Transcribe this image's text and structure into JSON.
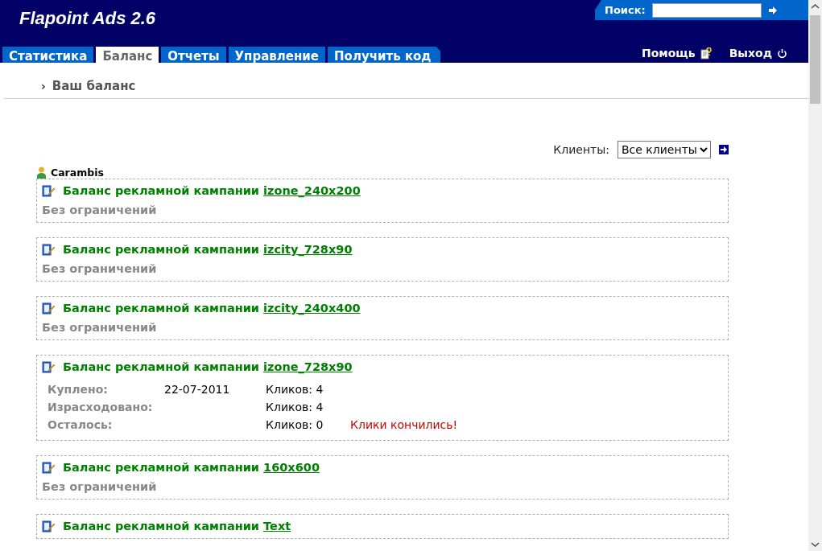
{
  "app": {
    "title": "Flapoint Ads 2.6"
  },
  "search": {
    "label": "Поиск:"
  },
  "tabs": [
    {
      "label": "Статистика",
      "selected": false
    },
    {
      "label": "Баланс",
      "selected": true
    },
    {
      "label": "Отчеты",
      "selected": false
    },
    {
      "label": "Управление",
      "selected": false
    },
    {
      "label": "Получить код",
      "selected": false
    }
  ],
  "top_links": [
    {
      "label": "Помощь",
      "kind": "help"
    },
    {
      "label": "Выход",
      "kind": "logout"
    }
  ],
  "breadcrumb": {
    "marker": "›",
    "label": "Ваш баланс"
  },
  "client_filter": {
    "label": "Клиенты:",
    "value": "Все клиенты"
  },
  "client": {
    "name": "Carambis"
  },
  "campaigns": [
    {
      "kind": "unlimited",
      "title": "Баланс рекламной кампании",
      "link": "izone_240x200",
      "status": "Без ограничений"
    },
    {
      "kind": "unlimited",
      "title": "Баланс рекламной кампании",
      "link": "izcity_728x90",
      "status": "Без ограничений"
    },
    {
      "kind": "unlimited",
      "title": "Баланс рекламной кампании",
      "link": "izcity_240x400",
      "status": "Без ограничений"
    },
    {
      "kind": "details",
      "title": "Баланс рекламной кампании",
      "link": "izone_728x90",
      "rows": [
        {
          "label": "Куплено:",
          "date": "22-07-2011",
          "clicks": "Кликов: 4"
        },
        {
          "label": "Израсходовано:",
          "clicks": "Кликов: 4"
        },
        {
          "label": "Осталось:",
          "clicks": "Кликов: 0",
          "note": "Клики кончились!"
        }
      ]
    },
    {
      "kind": "unlimited",
      "title": "Баланс рекламной кампании",
      "link": "160x600",
      "status": "Без ограничений"
    },
    {
      "kind": "partial",
      "title": "Баланс рекламной кампании",
      "link": "Text"
    }
  ]
}
